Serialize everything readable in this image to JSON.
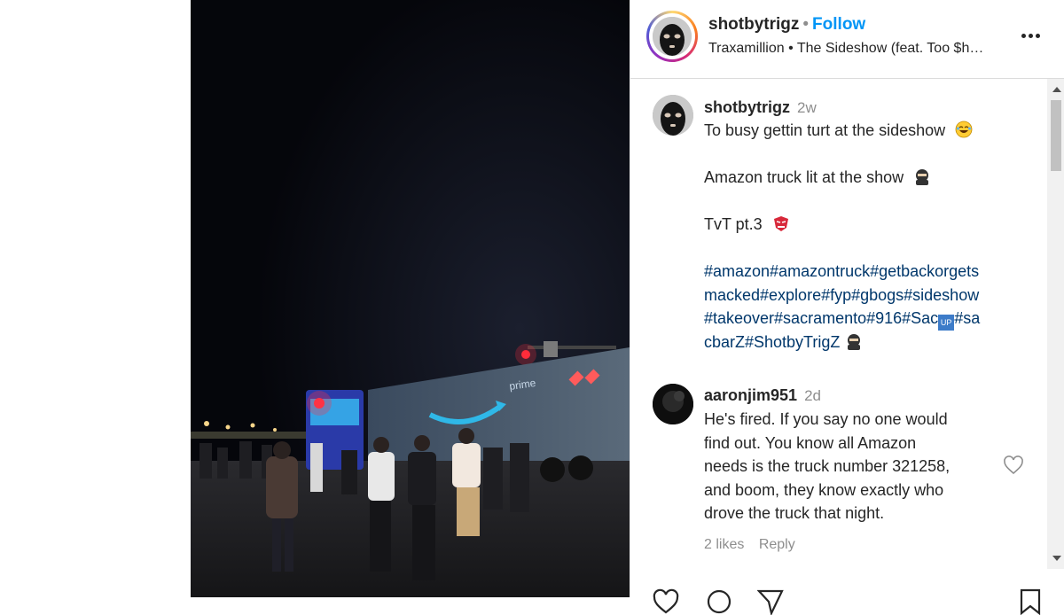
{
  "header": {
    "username": "shotbytrigz",
    "separator": "•",
    "follow_label": "Follow",
    "audio": "Traxamillion • The Sideshow (feat. Too $h…"
  },
  "caption": {
    "username": "shotbytrigz",
    "time": "2w",
    "line1": "To busy gettin turt at the sideshow",
    "line2": "Amazon truck lit at the show",
    "line3": "TvT pt.3",
    "hashtag_line1": "#amazon#amazontruck#getbackorgets",
    "hashtag_line2": "macked#explore#fyp#gbogs#sideshow",
    "hashtag_line3a": "#takeover#sacramento#916#Sac",
    "hashtag_line3b": "#sa",
    "hashtag_line4": "cbarZ#ShotbyTrigZ"
  },
  "comment": {
    "username": "aaronjim951",
    "time": "2d",
    "lines": [
      "He's fired. If you say no one would",
      "find out. You know all Amazon",
      "needs is the truck number 321258,",
      "and boom, they know exactly who",
      "drove the truck that night."
    ],
    "likes": "2 likes",
    "reply_label": "Reply"
  },
  "video": {
    "truck_logo_text": "prime"
  },
  "icons": {
    "more": "more-options-icon",
    "heart": "heart-icon",
    "comment": "comment-icon",
    "share": "share-icon",
    "save": "bookmark-icon"
  },
  "colors": {
    "link_blue": "#0095f6",
    "hashtag_blue": "#00376b",
    "muted_gray": "#8e8e8e",
    "text": "#262626"
  }
}
